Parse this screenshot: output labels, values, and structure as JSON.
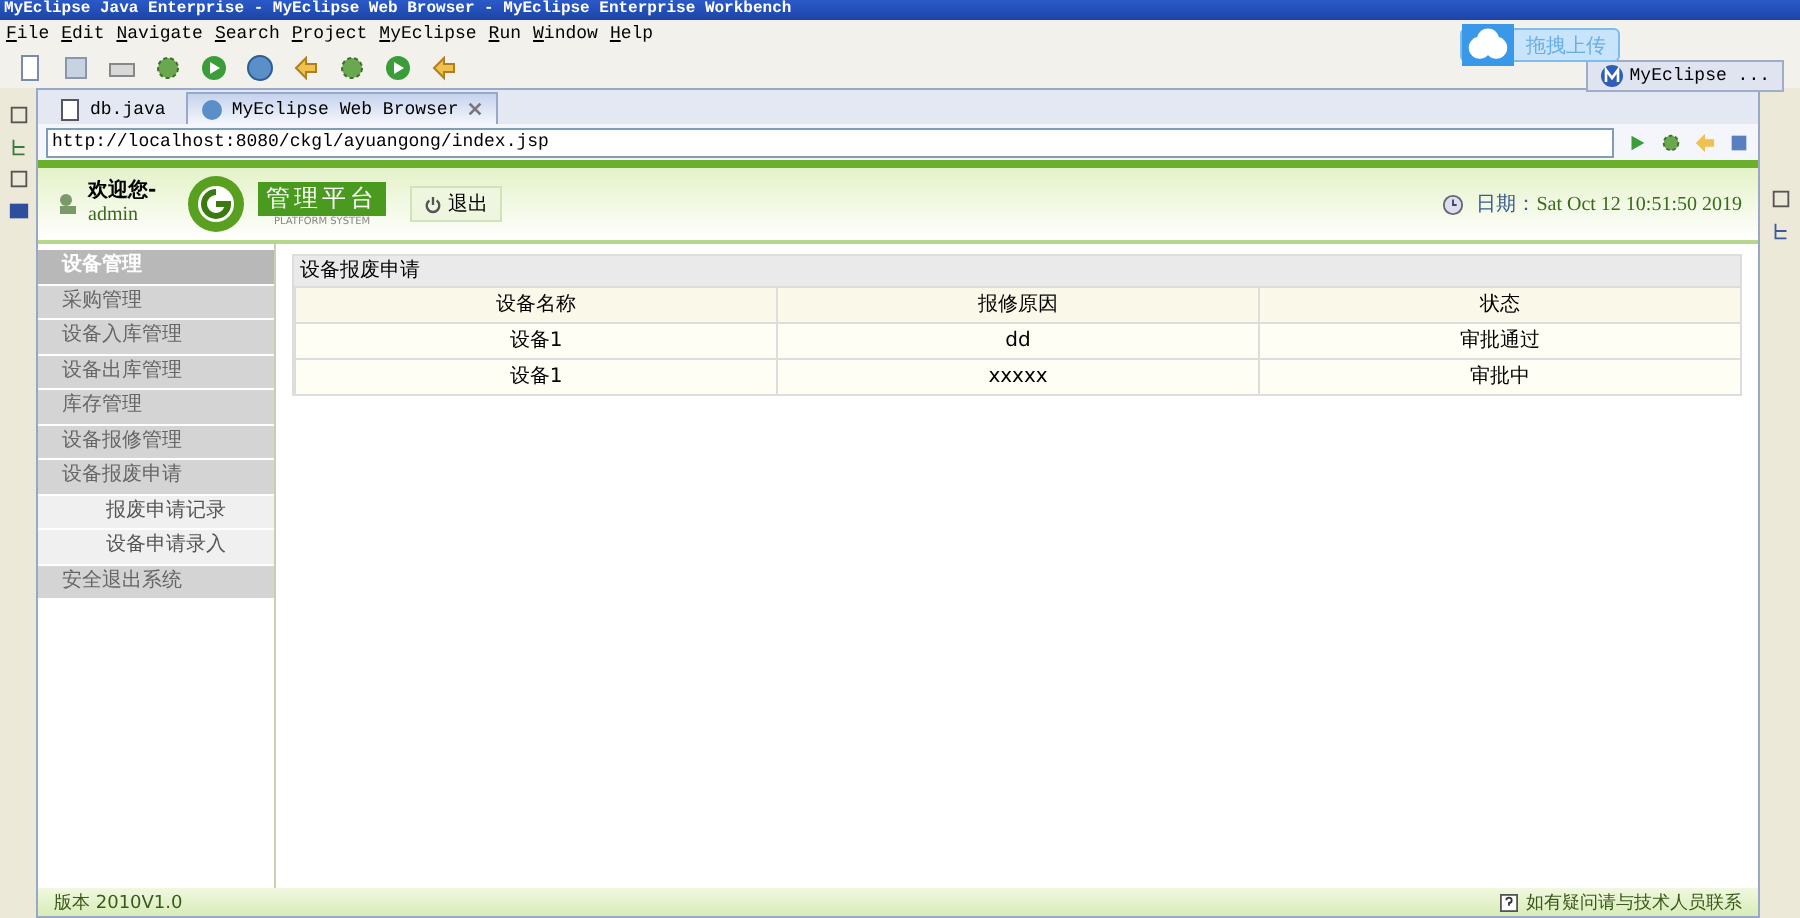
{
  "window": {
    "title": "MyEclipse Java Enterprise - MyEclipse Web Browser - MyEclipse Enterprise Workbench"
  },
  "menu": [
    "File",
    "Edit",
    "Navigate",
    "Search",
    "Project",
    "MyEclipse",
    "Run",
    "Window",
    "Help"
  ],
  "upload_button": "拖拽上传",
  "perspective": "MyEclipse ...",
  "editor_tabs": [
    {
      "label": "db.java",
      "selected": false,
      "kind": "java"
    },
    {
      "label": "MyEclipse Web Browser",
      "selected": true,
      "kind": "browser"
    }
  ],
  "url": "http://localhost:8080/ckgl/ayuangong/index.jsp",
  "page": {
    "welcome": "欢迎您-",
    "user": "admin",
    "logo_title": "管理平台",
    "logo_subtitle": "PLATFORM SYSTEM",
    "logout": "退出",
    "date_label": "日期：",
    "date": "Sat Oct 12 10:51:50 2019",
    "nav": [
      {
        "label": "设备管理",
        "kind": "header"
      },
      {
        "label": "采购管理",
        "kind": "item"
      },
      {
        "label": "设备入库管理",
        "kind": "item"
      },
      {
        "label": "设备出库管理",
        "kind": "item"
      },
      {
        "label": "库存管理",
        "kind": "item"
      },
      {
        "label": "设备报修管理",
        "kind": "item"
      },
      {
        "label": "设备报废申请",
        "kind": "item"
      },
      {
        "label": "报废申请记录",
        "kind": "subitem"
      },
      {
        "label": "设备申请录入",
        "kind": "subitem"
      },
      {
        "label": "安全退出系统",
        "kind": "item"
      }
    ],
    "panel_title": "设备报废申请",
    "table": {
      "columns": [
        "设备名称",
        "报修原因",
        "状态"
      ],
      "rows": [
        [
          "设备1",
          "dd",
          "审批通过"
        ],
        [
          "设备1",
          "xxxxx",
          "审批中"
        ]
      ]
    },
    "version": "版本 2010V1.0",
    "help": "如有疑问请与技术人员联系"
  }
}
